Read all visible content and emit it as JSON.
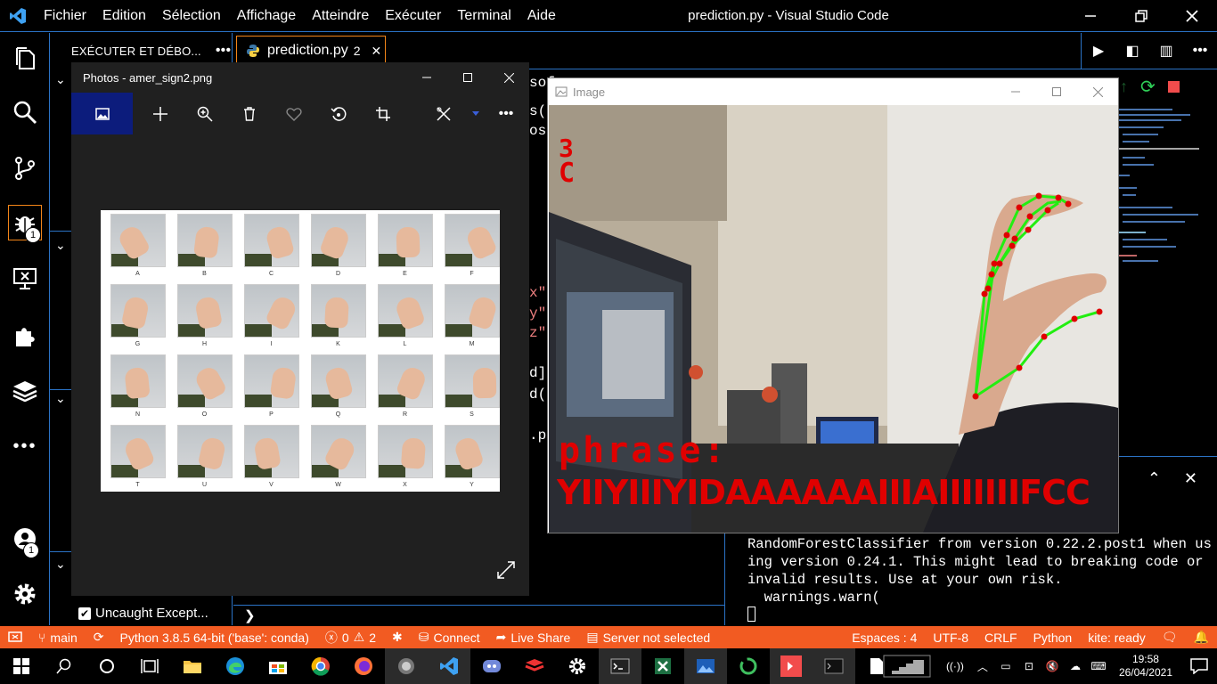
{
  "app": {
    "menu": [
      "Fichier",
      "Edition",
      "Sélection",
      "Affichage",
      "Atteindre",
      "Exécuter",
      "Terminal",
      "Aide"
    ],
    "window_title": "prediction.py - Visual Studio Code"
  },
  "activity_badges": {
    "debug": "1",
    "accounts": "1"
  },
  "sidebar": {
    "header": "EXÉCUTER ET DÉBO...",
    "more": "•••",
    "breakpoint_label": "Uncaught Except..."
  },
  "editor": {
    "tab_label": "prediction.py",
    "tab_count": "2",
    "code_fragments": [
      "sof",
      "s(",
      "os",
      "x\"",
      "y\"",
      "z\"",
      "d]",
      "d(",
      ".p"
    ]
  },
  "photos": {
    "title": "Photos - amer_sign2.png",
    "letters": [
      "A",
      "B",
      "C",
      "D",
      "E",
      "F",
      "G",
      "H",
      "I",
      "K",
      "L",
      "M",
      "N",
      "O",
      "P",
      "Q",
      "R",
      "S",
      "T",
      "U",
      "V",
      "W",
      "X",
      "Y"
    ]
  },
  "image_window": {
    "title": "Image",
    "overlay_count": "3",
    "overlay_letter": "C",
    "phrase_label": "phrase:",
    "phrase_value": "YIIYIIIYIDAAAAAAIIIAIIIIIIIFCC"
  },
  "terminal": {
    "lines": [
      "RandomForestClassifier from version 0.22.2.post1 when us",
      "ing version 0.24.1. This might lead to breaking code or",
      "invalid results. Use at your own risk.",
      "  warnings.warn("
    ]
  },
  "statusbar": {
    "branch": "main",
    "interpreter": "Python 3.8.5 64-bit ('base': conda)",
    "errors": "0",
    "warnings": "2",
    "connect": "Connect",
    "live_share": "Live Share",
    "server": "Server not selected",
    "spaces": "Espaces : 4",
    "encoding": "UTF-8",
    "eol": "CRLF",
    "language": "Python",
    "kite": "kite: ready"
  },
  "taskbar": {
    "time": "19:58",
    "date": "26/04/2021"
  },
  "colors": {
    "statusbar": "#f25b22",
    "accent_border": "#2b73c6",
    "tab_border": "#f38518",
    "overlay_red": "#e00000",
    "landmark_green": "#22ee11"
  }
}
